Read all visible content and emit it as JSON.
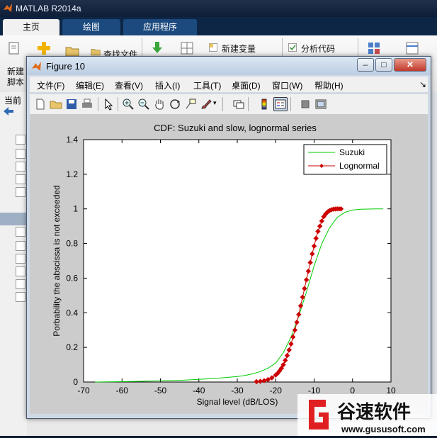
{
  "app": {
    "title": "MATLAB R2014a",
    "tabs": [
      {
        "label": "主页",
        "active": true
      },
      {
        "label": "绘图",
        "active": false
      },
      {
        "label": "应用程序",
        "active": false
      }
    ],
    "ribbon": {
      "new_script": "新建",
      "new_script_line2": "脚本",
      "find_files": "查找文件",
      "new_variable": "新建变量",
      "analyze_code": "分析代码"
    },
    "current_folder_label": "当前"
  },
  "figure": {
    "title": "Figure 10",
    "menu": [
      "文件(F)",
      "编辑(E)",
      "查看(V)",
      "插入(I)",
      "工具(T)",
      "桌面(D)",
      "窗口(W)",
      "帮助(H)"
    ],
    "toolbar": [
      "new-figure-icon",
      "open-file-icon",
      "save-icon",
      "print-icon",
      "edit-plot-arrow-icon",
      "zoom-in-icon",
      "zoom-out-icon",
      "pan-hand-icon",
      "rotate-3d-icon",
      "data-cursor-icon",
      "brush-icon",
      "link-plot-icon",
      "colorbar-icon",
      "legend-icon",
      "hide-plot-tools-icon",
      "show-plot-tools-icon"
    ]
  },
  "chart_data": {
    "type": "line",
    "title": "CDF: Suzuki and slow, lognormal series",
    "xlabel": "Signal level (dB/LOS)",
    "ylabel": "Porbability the abscissa is not exceeded",
    "xlim": [
      -70,
      10
    ],
    "ylim": [
      0,
      1.4
    ],
    "xticks": [
      "-70",
      "-60",
      "-50",
      "-40",
      "-30",
      "-20",
      "-10",
      "0",
      "10"
    ],
    "yticks": [
      "0",
      "0.2",
      "0.4",
      "0.6",
      "0.8",
      "1",
      "1.2",
      "1.4"
    ],
    "grid": false,
    "legend_position": "top-right",
    "series": [
      {
        "name": "Suzuki",
        "color": "#00cc00",
        "marker": "none",
        "x": [
          -67,
          -60,
          -55,
          -50,
          -45,
          -40,
          -35,
          -30,
          -28,
          -26,
          -24,
          -22,
          -20,
          -18,
          -16,
          -14,
          -12,
          -10,
          -8,
          -6,
          -4,
          -2,
          0,
          2,
          4,
          6,
          8
        ],
        "y": [
          0,
          0.002,
          0.004,
          0.007,
          0.01,
          0.015,
          0.022,
          0.032,
          0.038,
          0.047,
          0.06,
          0.08,
          0.11,
          0.17,
          0.26,
          0.38,
          0.52,
          0.67,
          0.8,
          0.89,
          0.95,
          0.98,
          0.993,
          0.998,
          0.999,
          1.0,
          1.0
        ]
      },
      {
        "name": "Lognormal",
        "color": "#cc0000",
        "marker": "diamond",
        "x": [
          -25,
          -24,
          -23,
          -22,
          -21,
          -20,
          -19.5,
          -19,
          -18.5,
          -18,
          -17.5,
          -17,
          -16.5,
          -16,
          -15.5,
          -15,
          -14.5,
          -14,
          -13.5,
          -13,
          -12.5,
          -12,
          -11.5,
          -11,
          -10.5,
          -10,
          -9.5,
          -9,
          -8.5,
          -8,
          -7.5,
          -7,
          -6.5,
          -6,
          -5.5,
          -5,
          -4.5,
          -4,
          -3.5,
          -3
        ],
        "y": [
          0.002,
          0.004,
          0.008,
          0.014,
          0.024,
          0.04,
          0.05,
          0.064,
          0.08,
          0.1,
          0.125,
          0.153,
          0.185,
          0.22,
          0.26,
          0.3,
          0.345,
          0.39,
          0.44,
          0.49,
          0.54,
          0.59,
          0.64,
          0.69,
          0.74,
          0.785,
          0.83,
          0.87,
          0.9,
          0.93,
          0.955,
          0.97,
          0.982,
          0.99,
          0.995,
          0.998,
          0.999,
          1.0,
          1.0,
          1.0
        ]
      }
    ]
  },
  "watermark": {
    "brand": "谷速软件",
    "url": "www.gususoft.com"
  }
}
